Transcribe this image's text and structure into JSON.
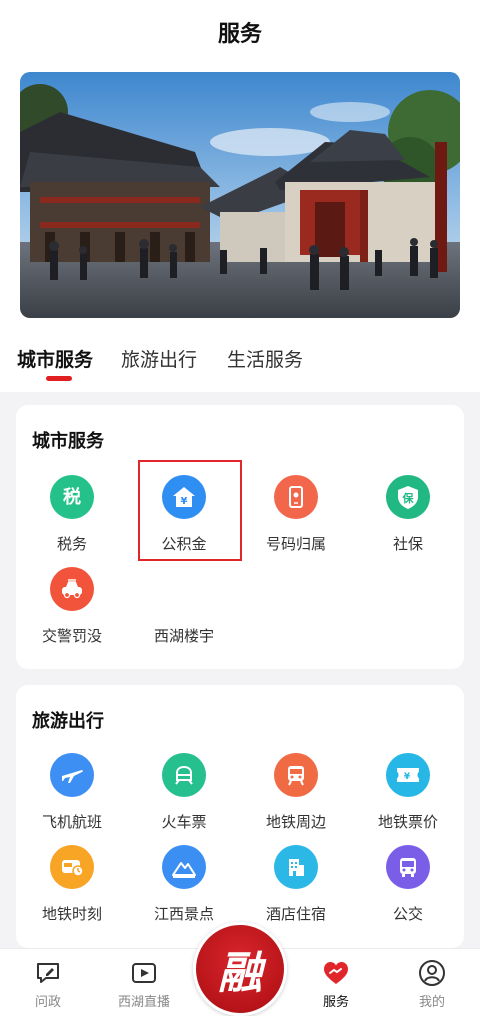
{
  "header": {
    "title": "服务"
  },
  "banner": {
    "alt": ""
  },
  "tabs": [
    {
      "label": "城市服务",
      "active": true
    },
    {
      "label": "旅游出行",
      "active": false
    },
    {
      "label": "生活服务",
      "active": false
    }
  ],
  "city_services": {
    "title": "城市服务",
    "items": [
      {
        "label": "税务",
        "icon": "tax-icon",
        "color": "#24c28a"
      },
      {
        "label": "公积金",
        "icon": "housing-fund-icon",
        "color": "#2f8ef2"
      },
      {
        "label": "号码归属",
        "icon": "phone-location-icon",
        "color": "#f2674c"
      },
      {
        "label": "社保",
        "icon": "social-security-icon",
        "color": "#22b884"
      },
      {
        "label": "交警罚没",
        "icon": "traffic-police-icon",
        "color": "#f1543a"
      },
      {
        "label": "西湖楼宇",
        "icon": "",
        "color": ""
      }
    ]
  },
  "travel": {
    "title": "旅游出行",
    "items": [
      {
        "label": "飞机航班",
        "icon": "airplane-icon",
        "color": "#3d8ff3"
      },
      {
        "label": "火车票",
        "icon": "train-icon",
        "color": "#25c08d"
      },
      {
        "label": "地铁周边",
        "icon": "subway-icon",
        "color": "#f06a44"
      },
      {
        "label": "地铁票价",
        "icon": "ticket-icon",
        "color": "#27b7e6"
      },
      {
        "label": "地铁时刻",
        "icon": "subway-schedule-icon",
        "color": "#f8a425"
      },
      {
        "label": "江西景点",
        "icon": "scenic-icon",
        "color": "#3b8ff2"
      },
      {
        "label": "酒店住宿",
        "icon": "hotel-icon",
        "color": "#2cb8e6"
      },
      {
        "label": "公交",
        "icon": "bus-icon",
        "color": "#7b5ee8"
      }
    ]
  },
  "bottom_nav": [
    {
      "label": "问政",
      "icon": "message-edit-icon"
    },
    {
      "label": "西湖直播",
      "icon": "video-play-icon"
    },
    {
      "label": "融",
      "icon": "center-logo"
    },
    {
      "label": "服务",
      "icon": "handshake-heart-icon",
      "active": true
    },
    {
      "label": "我的",
      "icon": "user-icon"
    }
  ],
  "colors": {
    "accent": "#e02020",
    "highlight_border": "#e0262b"
  }
}
